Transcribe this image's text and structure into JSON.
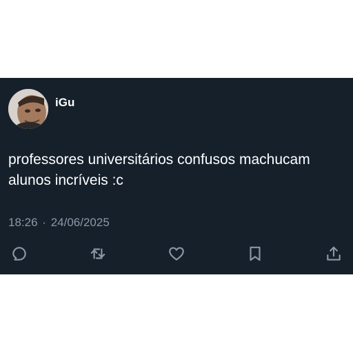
{
  "tweet": {
    "author": "iGu",
    "text": "professores universitários confusos machucam alunos incríveis :c",
    "time": "18:26",
    "separator": "·",
    "date": "24/06/2025"
  },
  "actions": {
    "reply": "reply-icon",
    "retweet": "retweet-icon",
    "like": "heart-icon",
    "bookmark": "bookmark-icon",
    "share": "share-icon"
  },
  "colors": {
    "background": "#15202b",
    "text": "#ffffff",
    "muted": "#8b98a5"
  }
}
